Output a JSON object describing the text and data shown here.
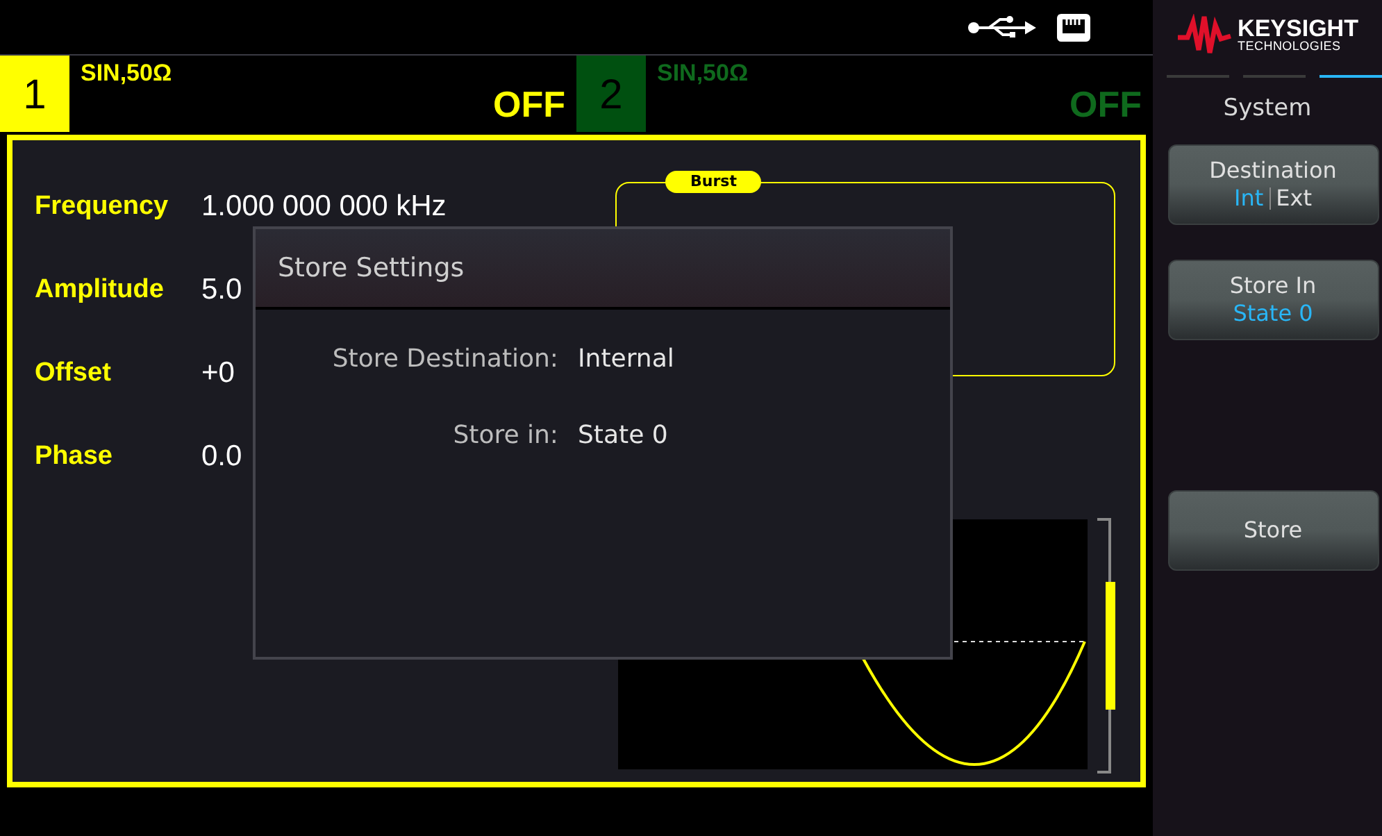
{
  "channels": [
    {
      "number": "1",
      "label": "SIN,50Ω",
      "output": "OFF",
      "selected": true
    },
    {
      "number": "2",
      "label": "SIN,50Ω",
      "output": "OFF",
      "selected": false
    }
  ],
  "parameters": [
    {
      "label": "Frequency",
      "value": "1.000 000 000 kHz"
    },
    {
      "label": "Amplitude",
      "value": "5.0"
    },
    {
      "label": "Offset",
      "value": "+0"
    },
    {
      "label": "Phase",
      "value": "0.0"
    }
  ],
  "burst": {
    "label": "Burst"
  },
  "dialog": {
    "title": "Store Settings",
    "fields": [
      {
        "label": "Store Destination:",
        "value": "Internal"
      },
      {
        "label": "Store in:",
        "value": "State 0"
      }
    ]
  },
  "brand": {
    "name": "KEYSIGHT",
    "sub": "TECHNOLOGIES"
  },
  "menu": {
    "pages": [
      {
        "selected": false
      },
      {
        "selected": false
      },
      {
        "selected": true
      }
    ],
    "title": "System",
    "softkeys": [
      {
        "kind": "toggle",
        "label": "Destination",
        "options": [
          {
            "label": "Int",
            "selected": true
          },
          {
            "label": "Ext",
            "selected": false
          }
        ]
      },
      {
        "kind": "value",
        "label": "Store In",
        "value": "State 0"
      },
      {
        "kind": "empty"
      },
      {
        "kind": "action",
        "label": "Store"
      }
    ]
  }
}
